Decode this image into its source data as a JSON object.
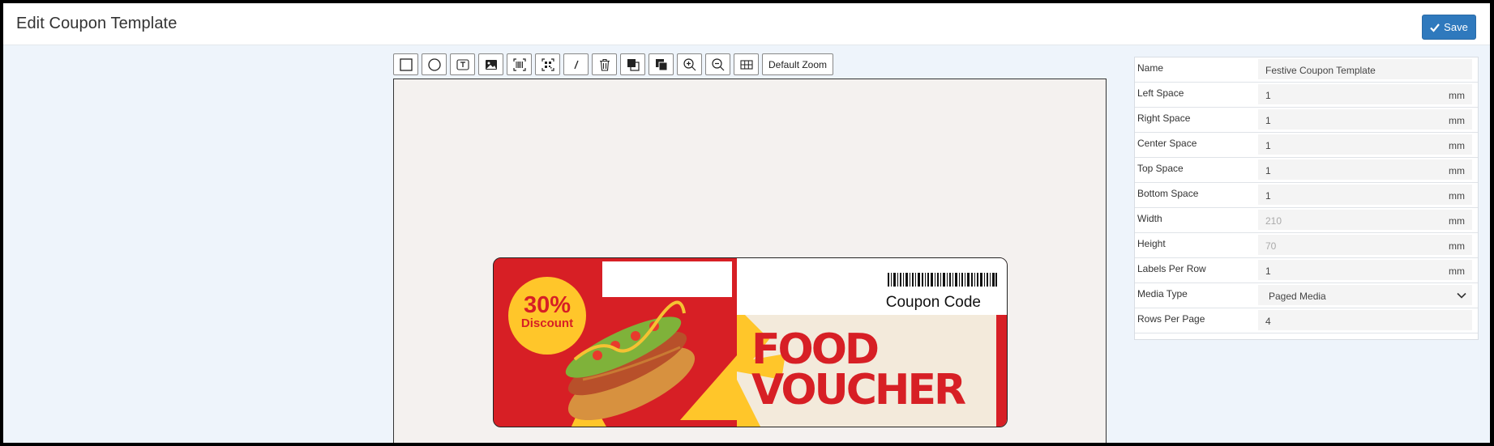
{
  "header": {
    "title": "Edit Coupon Template",
    "save_label": "Save"
  },
  "toolbar": {
    "tools": [
      "rectangle-tool-icon",
      "circle-tool-icon",
      "text-tool-icon",
      "image-tool-icon",
      "barcode-tool-icon",
      "qrcode-tool-icon",
      "line-tool-icon",
      "delete-icon",
      "bring-forward-icon",
      "send-backward-icon",
      "zoom-in-icon",
      "zoom-out-icon",
      "grid-icon"
    ],
    "default_zoom_label": "Default Zoom"
  },
  "coupon": {
    "discount_percent": "30%",
    "discount_label": "Discount",
    "code_label": "Coupon Code",
    "title_line1": "FOOD",
    "title_line2": "VOUCHER",
    "colors": {
      "red": "#d71f25",
      "yellow": "#ffc62a",
      "cream": "#f3eadb"
    }
  },
  "properties": {
    "name_label": "Name",
    "name_value": "Festive Coupon Template",
    "left_label": "Left Space",
    "left_value": "1",
    "right_label": "Right Space",
    "right_value": "1",
    "center_label": "Center Space",
    "center_value": "1",
    "top_label": "Top Space",
    "top_value": "1",
    "bottom_label": "Bottom Space",
    "bottom_value": "1",
    "width_label": "Width",
    "width_value": "210",
    "height_label": "Height",
    "height_value": "70",
    "lpr_label": "Labels Per Row",
    "lpr_value": "1",
    "media_label": "Media Type",
    "media_value": "Paged Media",
    "rpp_label": "Rows Per Page",
    "rpp_value": "4",
    "unit": "mm"
  },
  "colors": {
    "accent": "#2f79bd",
    "page_bg": "#eef4fb"
  }
}
